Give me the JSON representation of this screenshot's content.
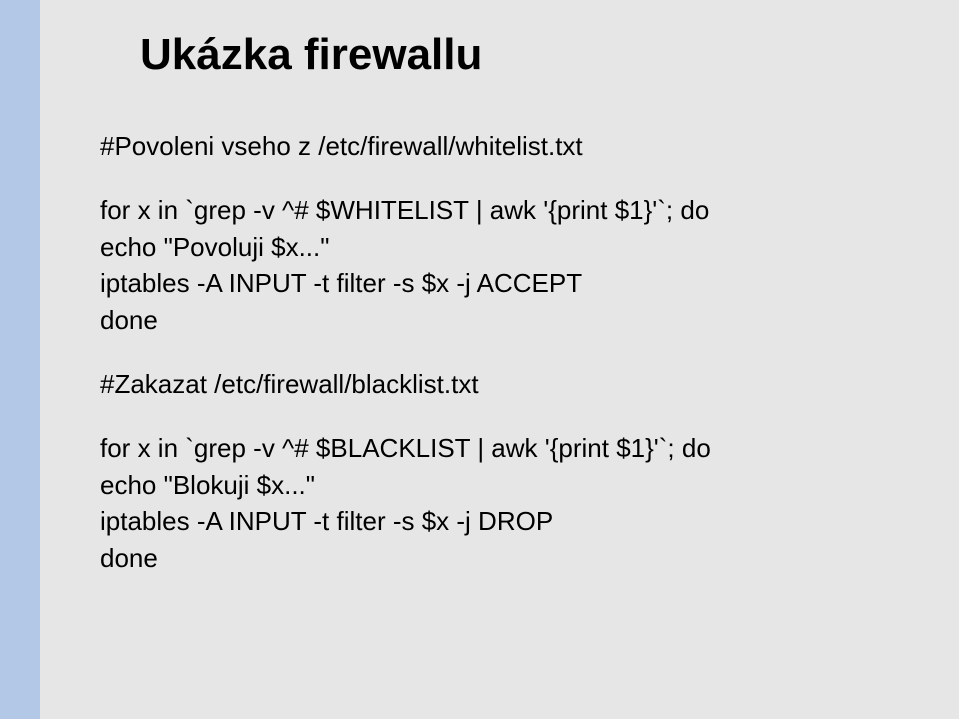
{
  "title": "Ukázka firewallu",
  "comment1": "#Povoleni vseho z /etc/firewall/whitelist.txt",
  "block1": {
    "line1": "for x in `grep -v ^# $WHITELIST | awk '{print $1}'`; do",
    "line2": "echo \"Povoluji $x...\"",
    "line3": "iptables -A INPUT -t filter -s $x -j ACCEPT",
    "line4": "done"
  },
  "comment2": "#Zakazat /etc/firewall/blacklist.txt",
  "block2": {
    "line1": "for x in `grep -v ^# $BLACKLIST | awk '{print $1}'`; do",
    "line2": "echo \"Blokuji $x...\"",
    "line3": "iptables -A INPUT -t filter -s $x -j DROP",
    "line4": "done"
  }
}
